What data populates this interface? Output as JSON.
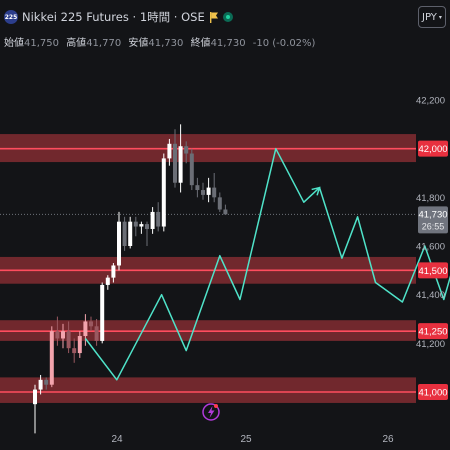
{
  "header": {
    "symbol_badge": "225",
    "title": "Nikkei 225 Futures · 1時間 · OSE",
    "currency": "JPY",
    "currency_arrow": "▾"
  },
  "ohlc": {
    "open_label": "始値",
    "open": "41,750",
    "high_label": "高値",
    "high": "41,770",
    "low_label": "安値",
    "low": "41,730",
    "close_label": "終値",
    "close": "41,730",
    "change": "-10 (-0.02%)"
  },
  "colors": {
    "background": "#131417",
    "up": "#ffffff",
    "down": "#6b6e76",
    "up_pink": "#f3a4ad",
    "zone_fill": "#7a2a30",
    "zone_line": "#ff4d5e",
    "projection": "#4fe3c9",
    "price_badge": "#70747e",
    "level_badge": "#e8303f"
  },
  "chart_data": {
    "type": "candlestick",
    "interval": "1h",
    "y_axis": {
      "min": 40750,
      "max": 42300,
      "ticks": [
        42200,
        41800,
        41600,
        41400,
        41200
      ]
    },
    "x_axis": {
      "ticks": [
        "24",
        "25",
        "26"
      ]
    },
    "current_price": {
      "value": "41,730",
      "countdown": "26:55"
    },
    "levels": [
      "42,000",
      "41,500",
      "41,250",
      "41,000"
    ],
    "support_resistance_zones": [
      {
        "label": "42,000",
        "level": 42000,
        "zone": [
          41945,
          42060
        ]
      },
      {
        "label": "41,500",
        "level": 41500,
        "zone": [
          41445,
          41555
        ]
      },
      {
        "label": "41,250",
        "level": 41250,
        "zone": [
          41210,
          41295
        ]
      },
      {
        "label": "41,000",
        "level": 41000,
        "zone": [
          40955,
          41060
        ]
      }
    ],
    "candles": [
      {
        "o": 40950,
        "h": 41030,
        "l": 40830,
        "c": 41010
      },
      {
        "o": 41010,
        "h": 41070,
        "l": 40990,
        "c": 41050
      },
      {
        "o": 41050,
        "h": 41060,
        "l": 41010,
        "c": 41030
      },
      {
        "o": 41030,
        "h": 41270,
        "l": 41020,
        "c": 41250
      },
      {
        "o": 41250,
        "h": 41310,
        "l": 41190,
        "c": 41220
      },
      {
        "o": 41220,
        "h": 41280,
        "l": 41180,
        "c": 41250
      },
      {
        "o": 41250,
        "h": 41290,
        "l": 41160,
        "c": 41180
      },
      {
        "o": 41180,
        "h": 41220,
        "l": 41120,
        "c": 41160
      },
      {
        "o": 41160,
        "h": 41250,
        "l": 41140,
        "c": 41230
      },
      {
        "o": 41230,
        "h": 41320,
        "l": 41190,
        "c": 41290
      },
      {
        "o": 41290,
        "h": 41310,
        "l": 41250,
        "c": 41270
      },
      {
        "o": 41270,
        "h": 41300,
        "l": 41190,
        "c": 41210
      },
      {
        "o": 41210,
        "h": 41450,
        "l": 41200,
        "c": 41440
      },
      {
        "o": 41440,
        "h": 41480,
        "l": 41420,
        "c": 41470
      },
      {
        "o": 41470,
        "h": 41530,
        "l": 41450,
        "c": 41520
      },
      {
        "o": 41520,
        "h": 41740,
        "l": 41500,
        "c": 41700
      },
      {
        "o": 41700,
        "h": 41720,
        "l": 41580,
        "c": 41600
      },
      {
        "o": 41600,
        "h": 41720,
        "l": 41590,
        "c": 41700
      },
      {
        "o": 41700,
        "h": 41720,
        "l": 41640,
        "c": 41680
      },
      {
        "o": 41680,
        "h": 41700,
        "l": 41650,
        "c": 41690
      },
      {
        "o": 41690,
        "h": 41700,
        "l": 41600,
        "c": 41670
      },
      {
        "o": 41670,
        "h": 41760,
        "l": 41650,
        "c": 41740
      },
      {
        "o": 41740,
        "h": 41780,
        "l": 41660,
        "c": 41680
      },
      {
        "o": 41680,
        "h": 41980,
        "l": 41660,
        "c": 41960
      },
      {
        "o": 41960,
        "h": 42040,
        "l": 41930,
        "c": 42020
      },
      {
        "o": 42020,
        "h": 42080,
        "l": 41840,
        "c": 41860
      },
      {
        "o": 41860,
        "h": 42100,
        "l": 41820,
        "c": 42010
      },
      {
        "o": 42010,
        "h": 42030,
        "l": 41940,
        "c": 41980
      },
      {
        "o": 41980,
        "h": 42000,
        "l": 41830,
        "c": 41850
      },
      {
        "o": 41850,
        "h": 41880,
        "l": 41800,
        "c": 41830
      },
      {
        "o": 41830,
        "h": 41860,
        "l": 41790,
        "c": 41810
      },
      {
        "o": 41810,
        "h": 41880,
        "l": 41780,
        "c": 41840
      },
      {
        "o": 41840,
        "h": 41900,
        "l": 41780,
        "c": 41800
      },
      {
        "o": 41800,
        "h": 41820,
        "l": 41740,
        "c": 41750
      },
      {
        "o": 41750,
        "h": 41770,
        "l": 41730,
        "c": 41730
      }
    ],
    "projection_path": [
      [
        0.0,
        41220
      ],
      [
        5.6,
        41050
      ],
      [
        13.6,
        41400
      ],
      [
        18.0,
        41170
      ],
      [
        24.0,
        41560
      ],
      [
        27.6,
        41380
      ],
      [
        34.0,
        42000
      ],
      [
        39.0,
        41780
      ],
      [
        41.8,
        41840
      ],
      [
        45.8,
        41550
      ],
      [
        48.6,
        41720
      ],
      [
        51.8,
        41450
      ],
      [
        56.6,
        41370
      ],
      [
        60.6,
        41600
      ],
      [
        64.0,
        41380
      ],
      [
        68.0,
        41700
      ],
      [
        72.0,
        41420
      ],
      [
        74.0,
        41460
      ]
    ]
  },
  "icons": {
    "event": "lightning-icon"
  }
}
